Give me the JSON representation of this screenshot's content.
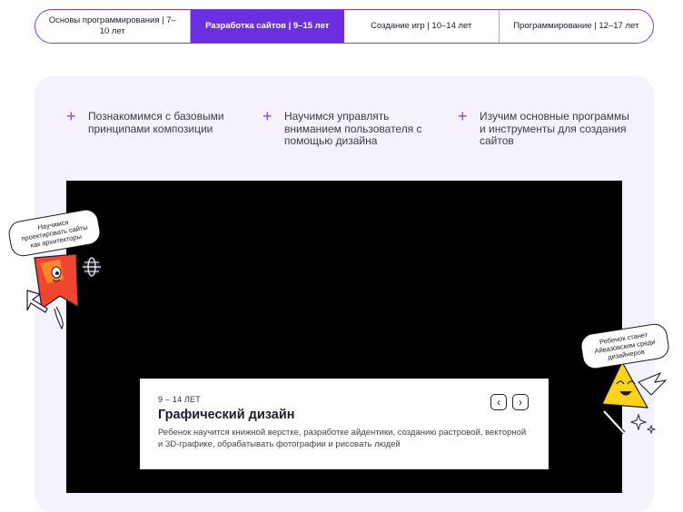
{
  "tabs": [
    {
      "label": "Основы программирования | 7–10 лет",
      "active": false
    },
    {
      "label": "Разработка сайтов | 9–15 лет",
      "active": true
    },
    {
      "label": "Создание игр | 10–14 лет",
      "active": false
    },
    {
      "label": "Программирование | 12–17 лет",
      "active": false
    }
  ],
  "features": [
    "Познакомимся с базовыми принципами композиции",
    "Научимся управлять вниманием пользователя с помощью дизайна",
    "Изучим основные программы и инструменты для создания сайтов"
  ],
  "card": {
    "age": "9 – 14 ЛЕТ",
    "title": "Графический дизайн",
    "description": "Ребенок научится книжной верстке, разработке айдентики, созданию растровой, векторной и 3D-графике, обрабатывать фотографии и рисовать людей",
    "prev": "‹",
    "next": "›"
  },
  "bubbles": {
    "left": "Научимся проектировать сайты как архитекторы",
    "right": "Ребенок станет Айвазовским среди дизайнеров"
  },
  "colors": {
    "accent": "#6b2fe0",
    "panel": "#f5f1fd",
    "plus": "#8a44e8"
  }
}
